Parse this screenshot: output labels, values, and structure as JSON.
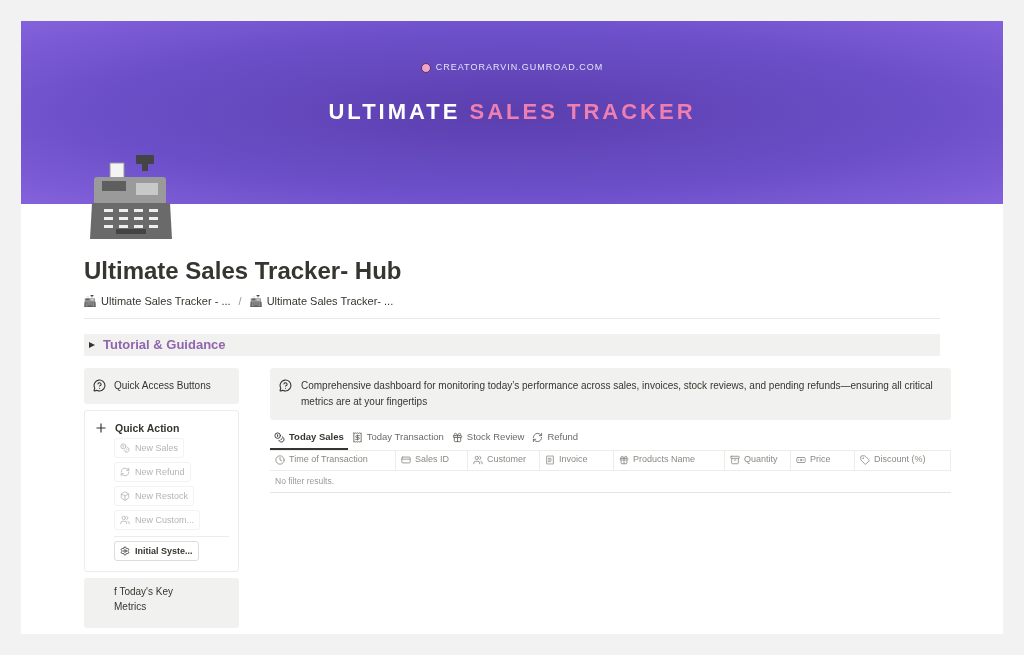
{
  "banner": {
    "site": "CREATORARVIN.GUMROAD.COM",
    "title_main": "ULTIMATE",
    "title_accent": "SALES TRACKER"
  },
  "page": {
    "title": "Ultimate Sales Tracker- Hub"
  },
  "breadcrumbs": [
    "Ultimate Sales Tracker - ...",
    "Ultimate Sales Tracker- ..."
  ],
  "breadcrumb_separator": "/",
  "toggle": {
    "label": "Tutorial & Guidance",
    "expanded": false
  },
  "sidebar": {
    "callout": "Quick Access Buttons",
    "section_title": "Quick Action",
    "buttons": [
      {
        "label": "New Sales",
        "disabled": true
      },
      {
        "label": "New Refund",
        "disabled": true
      },
      {
        "label": "New Restock",
        "disabled": true
      },
      {
        "label": "New Custom...",
        "disabled": true
      }
    ],
    "setup_button": {
      "label": "Initial Syste...",
      "disabled": false
    },
    "metrics_callout": "f Today's Key Metrics"
  },
  "callout": "Comprehensive dashboard for monitoring today’s performance across sales, invoices, stock reviews, and pending refunds—ensuring all critical metrics are at your fingertips",
  "tabs": [
    {
      "label": "Today Sales",
      "selected": true
    },
    {
      "label": "Today Transaction",
      "selected": false
    },
    {
      "label": "Stock Review",
      "selected": false
    },
    {
      "label": "Refund",
      "selected": false
    }
  ],
  "table": {
    "columns": [
      "Time of Transaction",
      "Sales ID",
      "Customer",
      "Invoice",
      "Products Name",
      "Quantity",
      "Price",
      "Discount (%)"
    ],
    "empty_message": "No filter results."
  }
}
